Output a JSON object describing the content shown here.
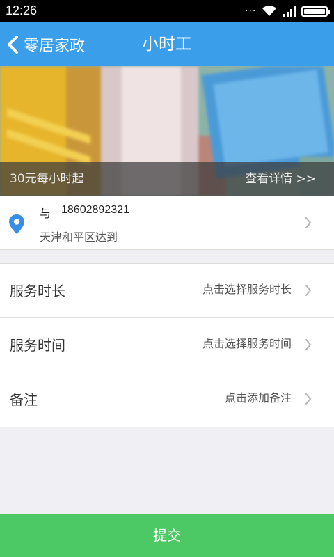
{
  "status_bar": {
    "time": "12:26",
    "dots": "···"
  },
  "nav": {
    "back_label": "零居家政",
    "title": "小时工"
  },
  "banner": {
    "price_text": "30元每小时起",
    "detail_link": "查看详情 >>"
  },
  "address": {
    "name": "与",
    "phone": "18602892321",
    "location": "天津和平区达到"
  },
  "form_rows": [
    {
      "label": "服务时长",
      "value": "点击选择服务时长"
    },
    {
      "label": "服务时间",
      "value": "点击选择服务时间"
    },
    {
      "label": "备注",
      "value": "点击添加备注"
    }
  ],
  "submit": {
    "label": "提交"
  },
  "colors": {
    "nav": "#3b9eea",
    "submit": "#4cc964",
    "location_pin": "#3b8ee6"
  }
}
